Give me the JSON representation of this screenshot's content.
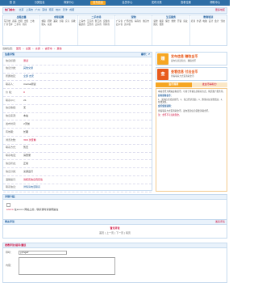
{
  "nav": [
    "首 页",
    "分类信息",
    "商家中心",
    "发布信息",
    "会员中心",
    "发布分类",
    "查看位置",
    "帮助中心"
  ],
  "cities": {
    "label": "热门城市：",
    "items": [
      "北京",
      "上海市",
      "广州",
      "深圳",
      "南京",
      "杭州",
      "天津",
      "成都"
    ],
    "more": "更多地区"
  },
  "categories": [
    {
      "title": "出租出售",
      "items": [
        "写字楼",
        "商铺",
        "出租",
        "出售",
        "土地",
        "厂房仓库",
        "二手房",
        "新房"
      ]
    },
    {
      "title": "求职招聘",
      "items": [
        "求职",
        "招聘",
        "兼职",
        "全职",
        "实习",
        "家教",
        "猎头",
        "派遣"
      ]
    },
    {
      "title": "二手市场",
      "items": [
        "上海市",
        "江苏省",
        "浙江省",
        "安徽省",
        "福建省",
        "江西省",
        "山东省",
        "河南省"
      ]
    },
    {
      "title": "宠物",
      "items": [
        "广东省",
        "广西壮族",
        "海南省",
        "重庆市",
        "四川省",
        "贵州省"
      ]
    },
    {
      "title": "生活服务",
      "items": [
        "装修",
        "搬家",
        "保洁",
        "维修",
        "开锁",
        "家政",
        "婚庆",
        "摄影"
      ]
    },
    {
      "title": "教育培训",
      "items": [
        "培训",
        "外语",
        "电脑",
        "设计",
        "会计",
        "驾校"
      ]
    }
  ],
  "crumb": [
    "首页",
    "全国",
    "交通",
    "吉安市",
    "其他"
  ],
  "crumbLabel": "当前位置：",
  "infoTitle": "信息详情",
  "infoId": "编号：7",
  "fields": [
    {
      "k": "信息标题：",
      "v": "测试",
      "c": "red"
    },
    {
      "k": "信息分类：",
      "v": "其他交通",
      "c": "blue"
    },
    {
      "k": "所属地区：",
      "v": "全部 吉安",
      "c": "blue"
    },
    {
      "k": "联系人：",
      "v": "mama测试",
      "c": ""
    },
    {
      "k": "价 格：",
      "v": "0",
      "c": "red"
    },
    {
      "k": "联系QQ：",
      "v": "21",
      "c": ""
    },
    {
      "k": "信息等级：",
      "v": "无",
      "c": ""
    },
    {
      "k": "信息来源：",
      "v": "本站",
      "c": ""
    },
    {
      "k": "发布时间：",
      "v": "2天前",
      "c": ""
    },
    {
      "k": "有效期：",
      "v": "长期",
      "c": ""
    },
    {
      "k": "浏览次数：",
      "v": "300 次查看",
      "c": "red"
    },
    {
      "k": "联系方式：",
      "v": "暂无",
      "c": ""
    },
    {
      "k": "联系电话：",
      "v": "请登录",
      "c": ""
    },
    {
      "k": "信息状态：",
      "v": "正常",
      "c": ""
    },
    {
      "k": "信息分类：",
      "v": "交通出行",
      "c": ""
    },
    {
      "k": "温馨提示：",
      "v": "请核实信息真实性",
      "c": "red"
    },
    {
      "k": "联系信息：",
      "v": "详情请电话联系",
      "c": "blue"
    }
  ],
  "banners": [
    {
      "badge": "赚",
      "t1": "发布信息 赚取金币",
      "t2": "发布信息送积分，赚取金币"
    },
    {
      "badge": "查",
      "t1": "查看信息 付出金币",
      "t2": "查看联系方式需消耗金币"
    }
  ],
  "tabs": [
    "金币规则",
    "发金币得积分"
  ],
  "rules": [
    {
      "text": "本站金币为网站虚拟货币，可用于查看信息联系方式，购买推广服务等。",
      "c": ""
    },
    {
      "text": "如何获得金币：",
      "c": "h"
    },
    {
      "text": "1、发布信息奖励金币；2、每日登录奖励；3、邀请好友注册奖励；4、在线充值。",
      "c": ""
    },
    {
      "text": "金币使用说明：",
      "c": "h"
    },
    {
      "text": "查看联系方式需消耗金币，发布置顶信息需要消耗金币。",
      "c": ""
    },
    {
      "text": "注：金币不可兑换现金。",
      "c": "r"
    }
  ],
  "detailTitle": "详细介绍：",
  "detailText": "在sooco 网站上的，联系我时请说明是在",
  "detailRed": "sooco",
  "commentsTitle": "网友评论",
  "commentsRight": "发表评论",
  "commentsCenter": "暂无评论",
  "pager": "首页 | 上一页 | 下一页 | 尾页",
  "formTitle": "发表评论/提问/建议",
  "formName": "称呼：",
  "formNameValue": "yjmgaf",
  "formContent": "内容："
}
